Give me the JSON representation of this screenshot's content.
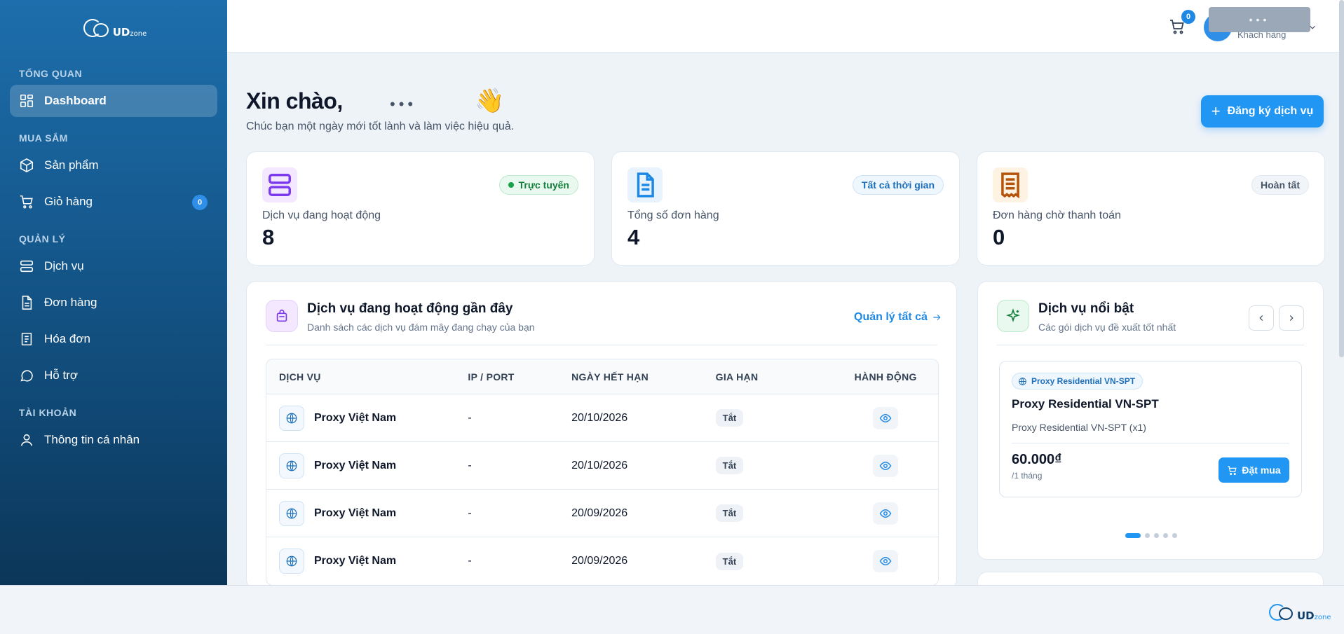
{
  "brand": {
    "logo_letters": "UD",
    "logo_suffix": "zone"
  },
  "sidebar": {
    "sections": [
      {
        "heading": "TỔNG QUAN",
        "items": [
          {
            "label": "Dashboard",
            "icon": "grid-icon",
            "active": true
          }
        ]
      },
      {
        "heading": "MUA SẮM",
        "items": [
          {
            "label": "Sản phẩm",
            "icon": "box-icon"
          },
          {
            "label": "Giỏ hàng",
            "icon": "cart-icon",
            "badge": "0"
          }
        ]
      },
      {
        "heading": "QUẢN LÝ",
        "items": [
          {
            "label": "Dịch vụ",
            "icon": "server-icon"
          },
          {
            "label": "Đơn hàng",
            "icon": "document-icon"
          },
          {
            "label": "Hóa đơn",
            "icon": "receipt-icon"
          },
          {
            "label": "Hỗ trợ",
            "icon": "chat-icon"
          }
        ]
      },
      {
        "heading": "TÀI KHOẢN",
        "items": [
          {
            "label": "Thông tin cá nhân",
            "icon": "user-icon"
          }
        ]
      }
    ]
  },
  "header": {
    "cart_count": "0",
    "user_role": "Khách hàng",
    "user_name_masked": "•••"
  },
  "greeting": {
    "title": "Xin chào,",
    "name_masked": "•••",
    "emoji": "👋",
    "subtitle": "Chúc bạn một ngày mới tốt lành và làm việc hiệu quả.",
    "register_label": "Đăng ký dịch vụ"
  },
  "stats": [
    {
      "label": "Dịch vụ đang hoạt động",
      "value": "8",
      "badge": "Trực tuyến",
      "icon": "server-icon",
      "accent": "#7c3aed"
    },
    {
      "label": "Tổng số đơn hàng",
      "value": "4",
      "badge": "Tất cả thời gian",
      "icon": "document-icon",
      "accent": "#1e88e5"
    },
    {
      "label": "Đơn hàng chờ thanh toán",
      "value": "0",
      "badge": "Hoàn tất",
      "icon": "receipt-icon",
      "accent": "#b45309"
    }
  ],
  "recent_services": {
    "title": "Dịch vụ đang hoạt động gần đây",
    "subtitle": "Danh sách các dịch vụ đám mây đang chạy của bạn",
    "manage_label": "Quản lý tất cả",
    "columns": [
      "DỊCH VỤ",
      "IP / PORT",
      "NGÀY HẾT HẠN",
      "GIA HẠN",
      "HÀNH ĐỘNG"
    ],
    "rows": [
      {
        "service": "Proxy Việt Nam",
        "ip": "-",
        "expiry": "20/10/2026",
        "renew": "Tắt"
      },
      {
        "service": "Proxy Việt Nam",
        "ip": "-",
        "expiry": "20/10/2026",
        "renew": "Tắt"
      },
      {
        "service": "Proxy Việt Nam",
        "ip": "-",
        "expiry": "20/09/2026",
        "renew": "Tắt"
      },
      {
        "service": "Proxy Việt Nam",
        "ip": "-",
        "expiry": "20/09/2026",
        "renew": "Tắt"
      }
    ]
  },
  "featured": {
    "title": "Dịch vụ nổi bật",
    "subtitle": "Các gói dịch vụ đề xuất tốt nhất",
    "product": {
      "tag": "Proxy Residential VN-SPT",
      "name": "Proxy Residential VN-SPT",
      "desc": "Proxy Residential VN-SPT (x1)",
      "price": "60.000₫",
      "period": "/1 tháng",
      "buy_label": "Đặt mua"
    },
    "slides": 5,
    "active_slide": 1
  },
  "colors": {
    "primary": "#2196f3",
    "sidebar_top": "#1d6eac",
    "sidebar_bottom": "#0c3658",
    "online": "#16a34a"
  }
}
